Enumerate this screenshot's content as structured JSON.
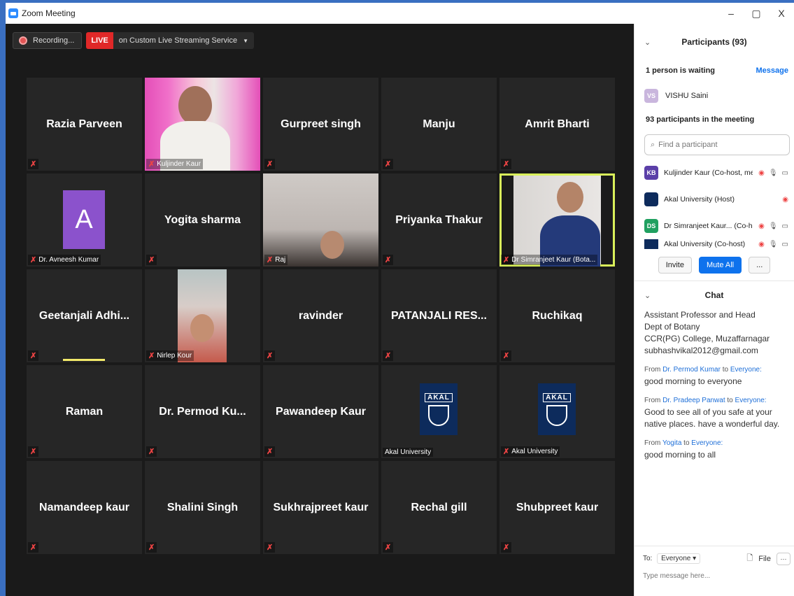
{
  "window": {
    "title": "Zoom Meeting",
    "minimize": "–",
    "maximize": "▢",
    "close": "X"
  },
  "top_bar": {
    "recording": "Recording...",
    "live": "LIVE",
    "streaming": "on Custom Live Streaming Service",
    "stream_caret": "▼"
  },
  "tiles": [
    {
      "name": "Razia Parveen",
      "label": ""
    },
    {
      "name": "",
      "label": "Kuljinder Kaur",
      "video": "pink"
    },
    {
      "name": "Gurpreet singh",
      "label": ""
    },
    {
      "name": "Manju",
      "label": ""
    },
    {
      "name": "Amrit Bharti",
      "label": ""
    },
    {
      "name": "",
      "label": "Dr. Avneesh Kumar",
      "avatar": "A"
    },
    {
      "name": "Yogita sharma",
      "label": ""
    },
    {
      "name": "",
      "label": "Raj",
      "video": "room"
    },
    {
      "name": "Priyanka Thakur",
      "label": ""
    },
    {
      "name": "",
      "label": "Dr Simranjeet Kaur (Bota...",
      "video": "room2",
      "active": true
    },
    {
      "name": "Geetanjali  Adhi...",
      "label": "",
      "speaking": true
    },
    {
      "name": "",
      "label": "Nirlep Kour",
      "video": "small"
    },
    {
      "name": "ravinder",
      "label": ""
    },
    {
      "name": "PATANJALI  RES...",
      "label": ""
    },
    {
      "name": "Ruchikaq",
      "label": ""
    },
    {
      "name": "Raman",
      "label": ""
    },
    {
      "name": "Dr. Permod  Ku...",
      "label": ""
    },
    {
      "name": "Pawandeep Kaur",
      "label": ""
    },
    {
      "name": "",
      "label": "Akal University",
      "logo": true,
      "muted": false
    },
    {
      "name": "",
      "label": "Akal University",
      "logo": true
    },
    {
      "name": "Namandeep kaur",
      "label": ""
    },
    {
      "name": "Shalini Singh",
      "label": ""
    },
    {
      "name": "Sukhrajpreet kaur",
      "label": ""
    },
    {
      "name": "Rechal gill",
      "label": ""
    },
    {
      "name": "Shubpreet kaur",
      "label": ""
    }
  ],
  "logo_text": {
    "word": "AKAL",
    "sub": "UNIVERSITY"
  },
  "participants": {
    "title": "Participants (93)",
    "waiting": "1 person is waiting",
    "message": "Message",
    "waiting_person": {
      "initials": "VS",
      "name": "VISHU Saini"
    },
    "count_line": "93 participants in the meeting",
    "search_placeholder": "Find a participant",
    "list": [
      {
        "initials": "KB",
        "name": "Kuljinder Kaur (Co-host, me)",
        "color": "#5b3fa8"
      },
      {
        "initials": "",
        "name": "Akal University (Host)",
        "color": "#0d2b5c"
      },
      {
        "initials": "DS",
        "name": "Dr Simranjeet Kaur... (Co-host)",
        "color": "#20a060"
      },
      {
        "initials": "",
        "name": "Akal University (Co-host)",
        "color": "#0d2b5c"
      }
    ],
    "invite": "Invite",
    "mute_all": "Mute All",
    "more": "..."
  },
  "chat": {
    "title": "Chat",
    "lines": [
      "Assistant Professor and Head",
      "Dept of Botany",
      "CCR(PG) College, Muzaffarnagar",
      "subhashvikal2012@gmail.com"
    ],
    "messages": [
      {
        "from": "From",
        "who": "Dr. Permod Kumar",
        "to": "to",
        "target": "Everyone:",
        "text": "good morning to everyone"
      },
      {
        "from": "From",
        "who": "Dr. Pradeep Panwat",
        "to": "to",
        "target": "Everyone:",
        "text": "Good to see all of you safe at your native places. have a wonderful day."
      },
      {
        "from": "From",
        "who": "Yogita",
        "to": "to",
        "target": "Everyone:",
        "text": "good morning  to all"
      }
    ],
    "to_label": "To:",
    "to_value": "Everyone ▾",
    "file": "File",
    "more": "···",
    "placeholder": "Type message here..."
  }
}
